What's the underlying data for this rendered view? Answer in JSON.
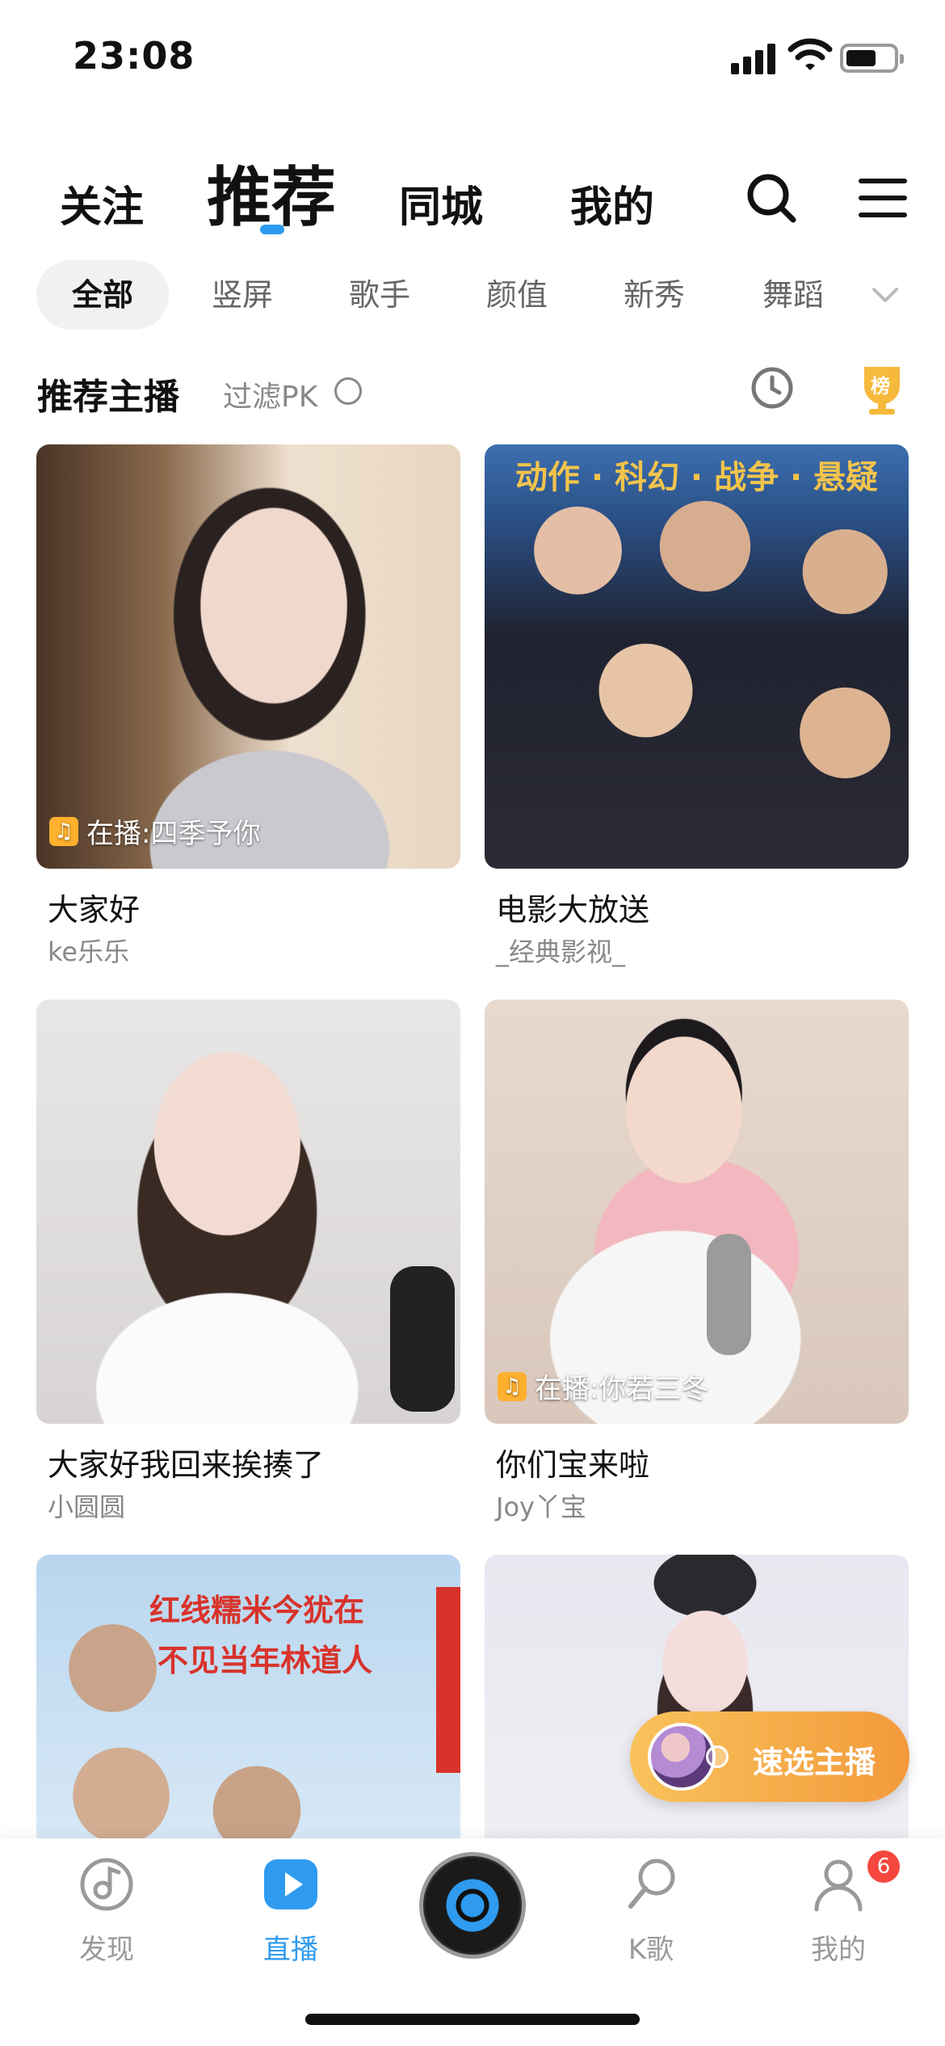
{
  "status_bar": {
    "time": "23:08"
  },
  "top_tabs": {
    "follow": "关注",
    "recommend": "推荐",
    "same_city": "同城",
    "mine": "我的"
  },
  "categories": [
    "全部",
    "竖屏",
    "歌手",
    "颜值",
    "新秀",
    "舞蹈"
  ],
  "section": {
    "title": "推荐主播",
    "filter": "过滤PK"
  },
  "rank_badge": "榜",
  "cards": [
    {
      "title": "大家好",
      "host": "ke乐乐",
      "now_playing": "在播:四季予你"
    },
    {
      "title": "电影大放送",
      "host": "_经典影视_",
      "poster_text": "动作 · 科幻 · 战争 · 悬疑"
    },
    {
      "title": "大家好我回来挨揍了",
      "host": "小圆圆"
    },
    {
      "title": "你们宝来啦",
      "host": "Joy丫宝",
      "now_playing": "在播:你若三冬"
    },
    {
      "poster_text_1": "红线糯米今犹在",
      "poster_text_2": "不见当年林道人"
    },
    {}
  ],
  "quick_select": {
    "label": "速选主播"
  },
  "bottom_nav": {
    "items": [
      {
        "label": "发现",
        "icon": "discover-note-icon"
      },
      {
        "label": "直播",
        "icon": "live-play-icon"
      },
      {
        "label": "",
        "icon": "vinyl-disc-icon"
      },
      {
        "label": "K歌",
        "icon": "karaoke-mic-icon"
      },
      {
        "label": "我的",
        "icon": "profile-icon"
      }
    ],
    "profile_badge": "6"
  },
  "colors": {
    "accent": "#2f9bf0",
    "badge": "#f4473e",
    "quick_select_start": "#f8c25a",
    "quick_select_end": "#f39a3c"
  }
}
